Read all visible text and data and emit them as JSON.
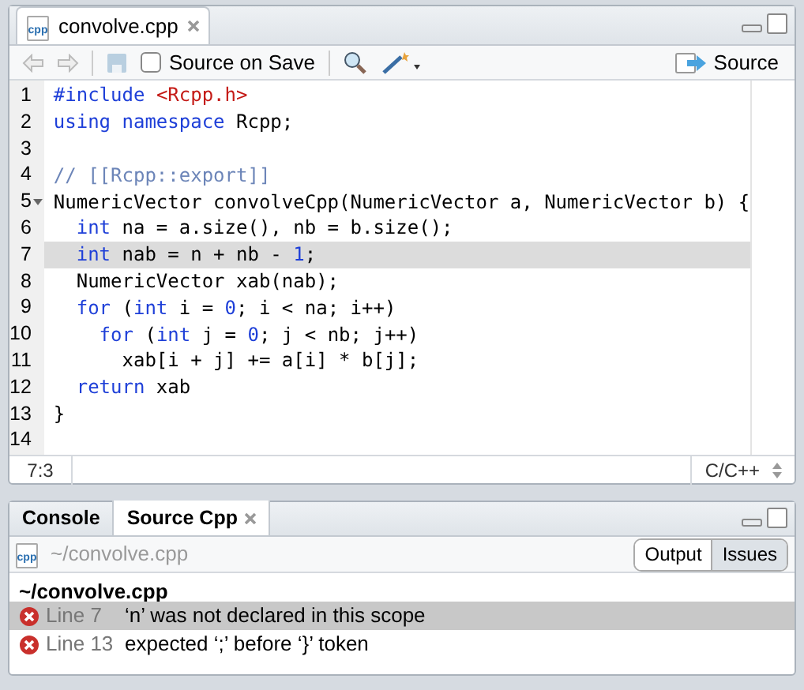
{
  "editor_tab": {
    "title": "convolve.cpp",
    "icon_label": "cpp"
  },
  "toolbar": {
    "source_on_save": {
      "label": "Source on Save",
      "checked": false
    },
    "source_button": "Source"
  },
  "code_lines": [
    {
      "number": "1",
      "selected": false,
      "fold": false,
      "tokens": [
        {
          "kind": "keyword",
          "text": "#include "
        },
        {
          "kind": "string",
          "text": "<Rcpp.h>"
        }
      ]
    },
    {
      "number": "2",
      "selected": false,
      "fold": false,
      "tokens": [
        {
          "kind": "keyword",
          "text": "using namespace "
        },
        {
          "kind": "plain",
          "text": "Rcpp;"
        }
      ]
    },
    {
      "number": "3",
      "selected": false,
      "fold": false
    },
    {
      "number": "4",
      "selected": false,
      "fold": false,
      "tokens": [
        {
          "kind": "comment",
          "text": "// [[Rcpp::export]]"
        }
      ]
    },
    {
      "number": "5",
      "selected": false,
      "fold": true,
      "tokens": [
        {
          "kind": "plain",
          "text": "NumericVector convolveCpp(NumericVector a, NumericVector b) {"
        }
      ]
    },
    {
      "number": "6",
      "selected": false,
      "fold": false,
      "tokens": [
        {
          "kind": "keyword",
          "text": "  int"
        },
        {
          "kind": "plain",
          "text": " na = a.size(), nb = b.size();"
        }
      ]
    },
    {
      "number": "7",
      "selected": true,
      "fold": false,
      "tokens": [
        {
          "kind": "keyword",
          "text": "  int"
        },
        {
          "kind": "plain",
          "text": " nab = n + nb - "
        },
        {
          "kind": "number",
          "text": "1"
        },
        {
          "kind": "plain",
          "text": ";"
        }
      ]
    },
    {
      "number": "8",
      "selected": false,
      "fold": false,
      "tokens": [
        {
          "kind": "plain",
          "text": "  NumericVector xab(nab);"
        }
      ]
    },
    {
      "number": "9",
      "selected": false,
      "fold": false,
      "tokens": [
        {
          "kind": "keyword",
          "text": "  for"
        },
        {
          "kind": "plain",
          "text": " ("
        },
        {
          "kind": "keyword",
          "text": "int"
        },
        {
          "kind": "plain",
          "text": " i = "
        },
        {
          "kind": "number",
          "text": "0"
        },
        {
          "kind": "plain",
          "text": "; i < na; i++)"
        }
      ]
    },
    {
      "number": "10",
      "selected": false,
      "fold": false,
      "tokens": [
        {
          "kind": "keyword",
          "text": "    for"
        },
        {
          "kind": "plain",
          "text": " ("
        },
        {
          "kind": "keyword",
          "text": "int"
        },
        {
          "kind": "plain",
          "text": " j = "
        },
        {
          "kind": "number",
          "text": "0"
        },
        {
          "kind": "plain",
          "text": "; j < nb; j++)"
        }
      ]
    },
    {
      "number": "11",
      "selected": false,
      "fold": false,
      "tokens": [
        {
          "kind": "plain",
          "text": "      xab[i + j] += a[i] * b[j];"
        }
      ]
    },
    {
      "number": "12",
      "selected": false,
      "fold": false,
      "tokens": [
        {
          "kind": "keyword",
          "text": "  return"
        },
        {
          "kind": "plain",
          "text": " xab"
        }
      ]
    },
    {
      "number": "13",
      "selected": false,
      "fold": false,
      "tokens": [
        {
          "kind": "plain",
          "text": "}"
        }
      ]
    },
    {
      "number": "14",
      "selected": false,
      "fold": false
    }
  ],
  "status_bar": {
    "position": "7:3",
    "language": "C/C++"
  },
  "bottom_tabs": [
    {
      "label": "Console",
      "selected": false,
      "closable": false
    },
    {
      "label": "Source Cpp",
      "selected": true,
      "closable": true
    }
  ],
  "bottom_toolbar": {
    "path": "~/convolve.cpp",
    "icon_label": "cpp",
    "views": [
      {
        "label": "Output",
        "selected": false
      },
      {
        "label": "Issues",
        "selected": true
      }
    ]
  },
  "issues": {
    "file": "~/convolve.cpp",
    "rows": [
      {
        "line": "Line 7",
        "message": "‘n’ was not declared in this scope",
        "selected": true
      },
      {
        "line": "Line 13",
        "message": "expected ‘;’ before ‘}’ token",
        "selected": false
      }
    ]
  }
}
